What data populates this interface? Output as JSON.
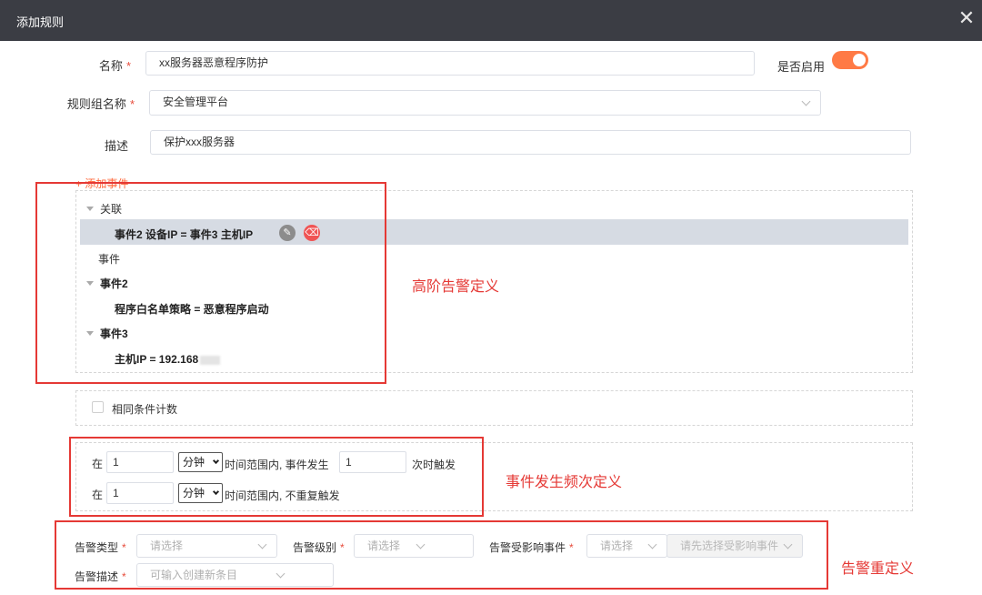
{
  "dialog": {
    "title": "添加规则",
    "close_icon": "close-icon"
  },
  "form": {
    "name_label": "名称",
    "name_value": "xx服务器恶意程序防护",
    "enable_label": "是否启用",
    "enabled": true,
    "group_label": "规则组名称",
    "group_value": "安全管理平台",
    "desc_label": "描述",
    "desc_value": "保护xxx服务器",
    "required_mark": "*"
  },
  "events": {
    "add_event": "+ 添加事件",
    "tree": [
      {
        "text": "关联"
      },
      {
        "text": "事件2 设备IP = 事件3 主机IP"
      },
      {
        "text": "事件"
      },
      {
        "text": "事件2"
      },
      {
        "text": "程序白名单策略 = 恶意程序启动"
      },
      {
        "text": "事件3"
      },
      {
        "text": "主机IP = 192.168"
      }
    ],
    "edit_icon": "✎",
    "delete_icon": "🗑"
  },
  "same_condition": {
    "label": "相同条件计数",
    "checked": false
  },
  "frequency": {
    "row1": {
      "prefix": "在",
      "value": "1",
      "unit": "分钟",
      "mid": "时间范围内, 事件发生",
      "count": "1",
      "suffix": "次时触发"
    },
    "row2": {
      "prefix": "在",
      "value": "1",
      "unit": "分钟",
      "mid": "时间范围内, 不重复触发"
    }
  },
  "alarm": {
    "type_label": "告警类型",
    "type_placeholder": "请选择",
    "level_label": "告警级别",
    "level_placeholder": "请选择",
    "affect_label": "告警受影响事件",
    "affect_placeholder": "请选择",
    "affect_sub_placeholder": "请先选择受影响事件",
    "desc_label": "告警描述",
    "desc_placeholder": "可输入创建新条目"
  },
  "annotations": {
    "advanced": "高阶告警定义",
    "frequency": "事件发生频次定义",
    "alarm": "告警重定义"
  }
}
